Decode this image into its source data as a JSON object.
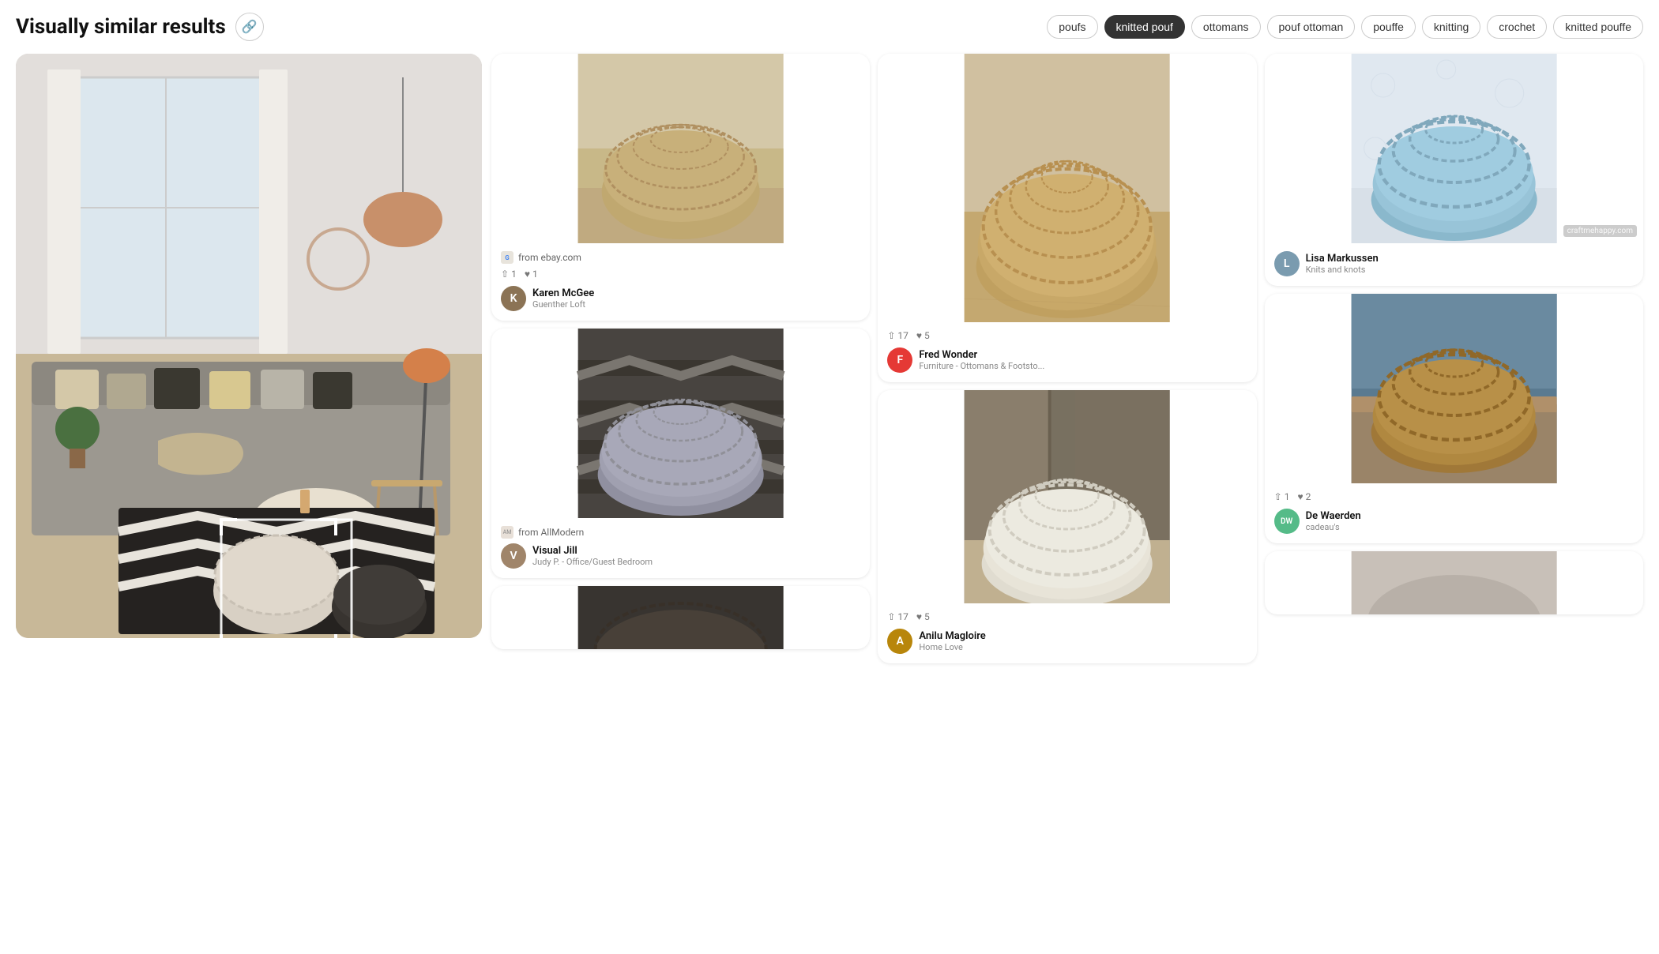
{
  "header": {
    "title": "Visually similar results",
    "link_icon": "🔗"
  },
  "tags": [
    {
      "label": "poufs",
      "active": false
    },
    {
      "label": "knitted pouf",
      "active": true
    },
    {
      "label": "ottomans",
      "active": false
    },
    {
      "label": "pouf ottoman",
      "active": false
    },
    {
      "label": "pouffe",
      "active": false
    },
    {
      "label": "knitting",
      "active": false
    },
    {
      "label": "crochet",
      "active": false
    },
    {
      "label": "knitted pouffe",
      "active": false
    }
  ],
  "col1": {
    "pin1": {
      "source": "from ebay.com",
      "stats": {
        "repins": "1",
        "likes": "1"
      },
      "user_name": "Karen McGee",
      "user_board": "Guenther Loft",
      "img_type": "tan",
      "img_height": "240"
    },
    "pin2": {
      "source": "from AllModern",
      "stats": {
        "repins": "",
        "likes": ""
      },
      "user_name": "Visual Jill",
      "user_board": "Judy P. - Office/Guest Bedroom",
      "img_type": "gray",
      "img_height": "240"
    },
    "pin3_partial": {
      "img_type": "dark",
      "img_height": "80"
    }
  },
  "col2": {
    "pin1": {
      "source": "",
      "stats": {
        "repins": "17",
        "likes": "5"
      },
      "user_name": "Fred Wonder",
      "user_board": "Furniture - Ottomans & Footsto...",
      "img_type": "beige",
      "img_height": "340"
    },
    "pin2": {
      "source": "",
      "stats": {
        "repins": "17",
        "likes": "5"
      },
      "user_name": "Anilu Magloire",
      "user_board": "Home Love",
      "img_type": "white",
      "img_height": "270"
    }
  },
  "col3": {
    "pin1": {
      "source": "",
      "watermark": "craftmehappy.com",
      "stats": {
        "repins": "",
        "likes": ""
      },
      "user_name": "Lisa Markussen",
      "user_board": "Knits and knots",
      "img_type": "blue",
      "img_height": "240"
    },
    "pin2": {
      "source": "",
      "stats": {
        "repins": "1",
        "likes": "2"
      },
      "user_name": "De Waerden",
      "user_board": "cadeau's",
      "img_type": "gold",
      "img_height": "240"
    },
    "pin3_partial": {
      "img_type": "scene",
      "img_height": "80"
    }
  },
  "icons": {
    "repin": "⇧",
    "heart": "♥",
    "link": "🔗"
  }
}
